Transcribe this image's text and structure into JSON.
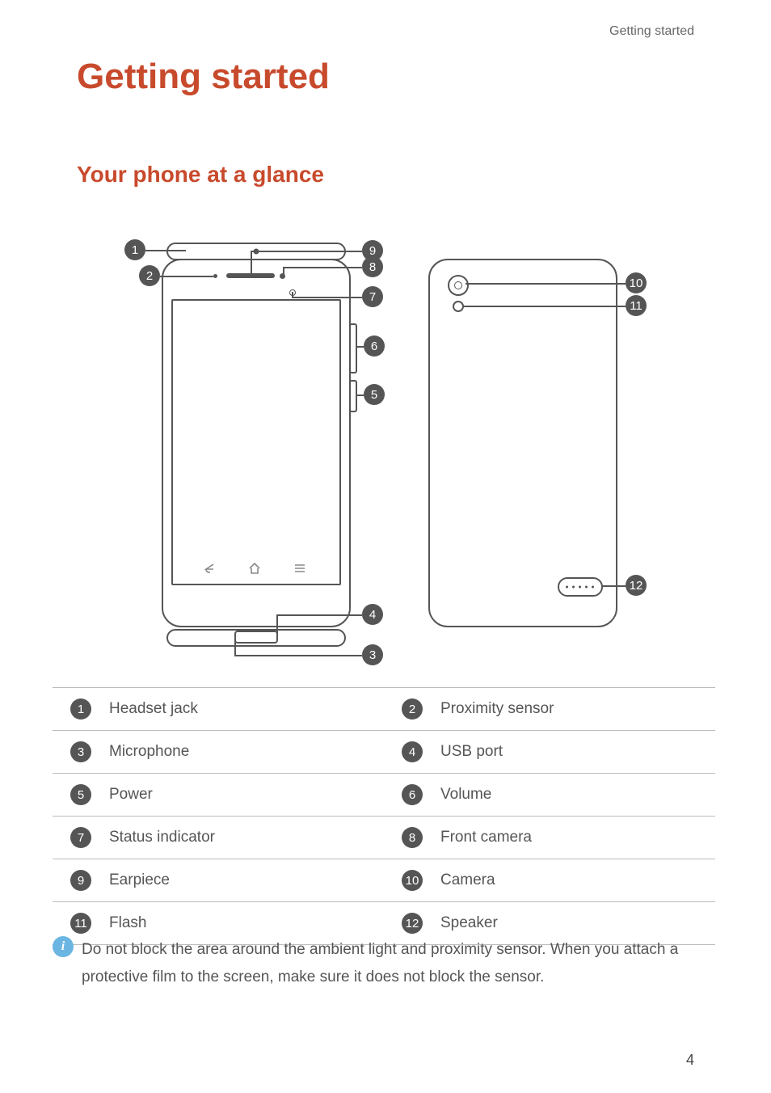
{
  "header_right": "Getting started",
  "page_title": "Getting started",
  "section_title": "Your phone at a glance",
  "callouts": [
    "1",
    "2",
    "3",
    "4",
    "5",
    "6",
    "7",
    "8",
    "9",
    "10",
    "11",
    "12"
  ],
  "parts_table": [
    {
      "num": "1",
      "label": "Headset jack",
      "num2": "2",
      "label2": "Proximity sensor"
    },
    {
      "num": "3",
      "label": "Microphone",
      "num2": "4",
      "label2": "USB port"
    },
    {
      "num": "5",
      "label": "Power",
      "num2": "6",
      "label2": "Volume"
    },
    {
      "num": "7",
      "label": "Status indicator",
      "num2": "8",
      "label2": "Front camera"
    },
    {
      "num": "9",
      "label": "Earpiece",
      "num2": "10",
      "label2": "Camera"
    },
    {
      "num": "11",
      "label": "Flash",
      "num2": "12",
      "label2": "Speaker"
    }
  ],
  "info_icon": "i",
  "note_text": "Do not block the area around the ambient light and proximity sensor. When you attach a protective film to the screen, make sure it does not block the sensor.",
  "page_number": "4"
}
